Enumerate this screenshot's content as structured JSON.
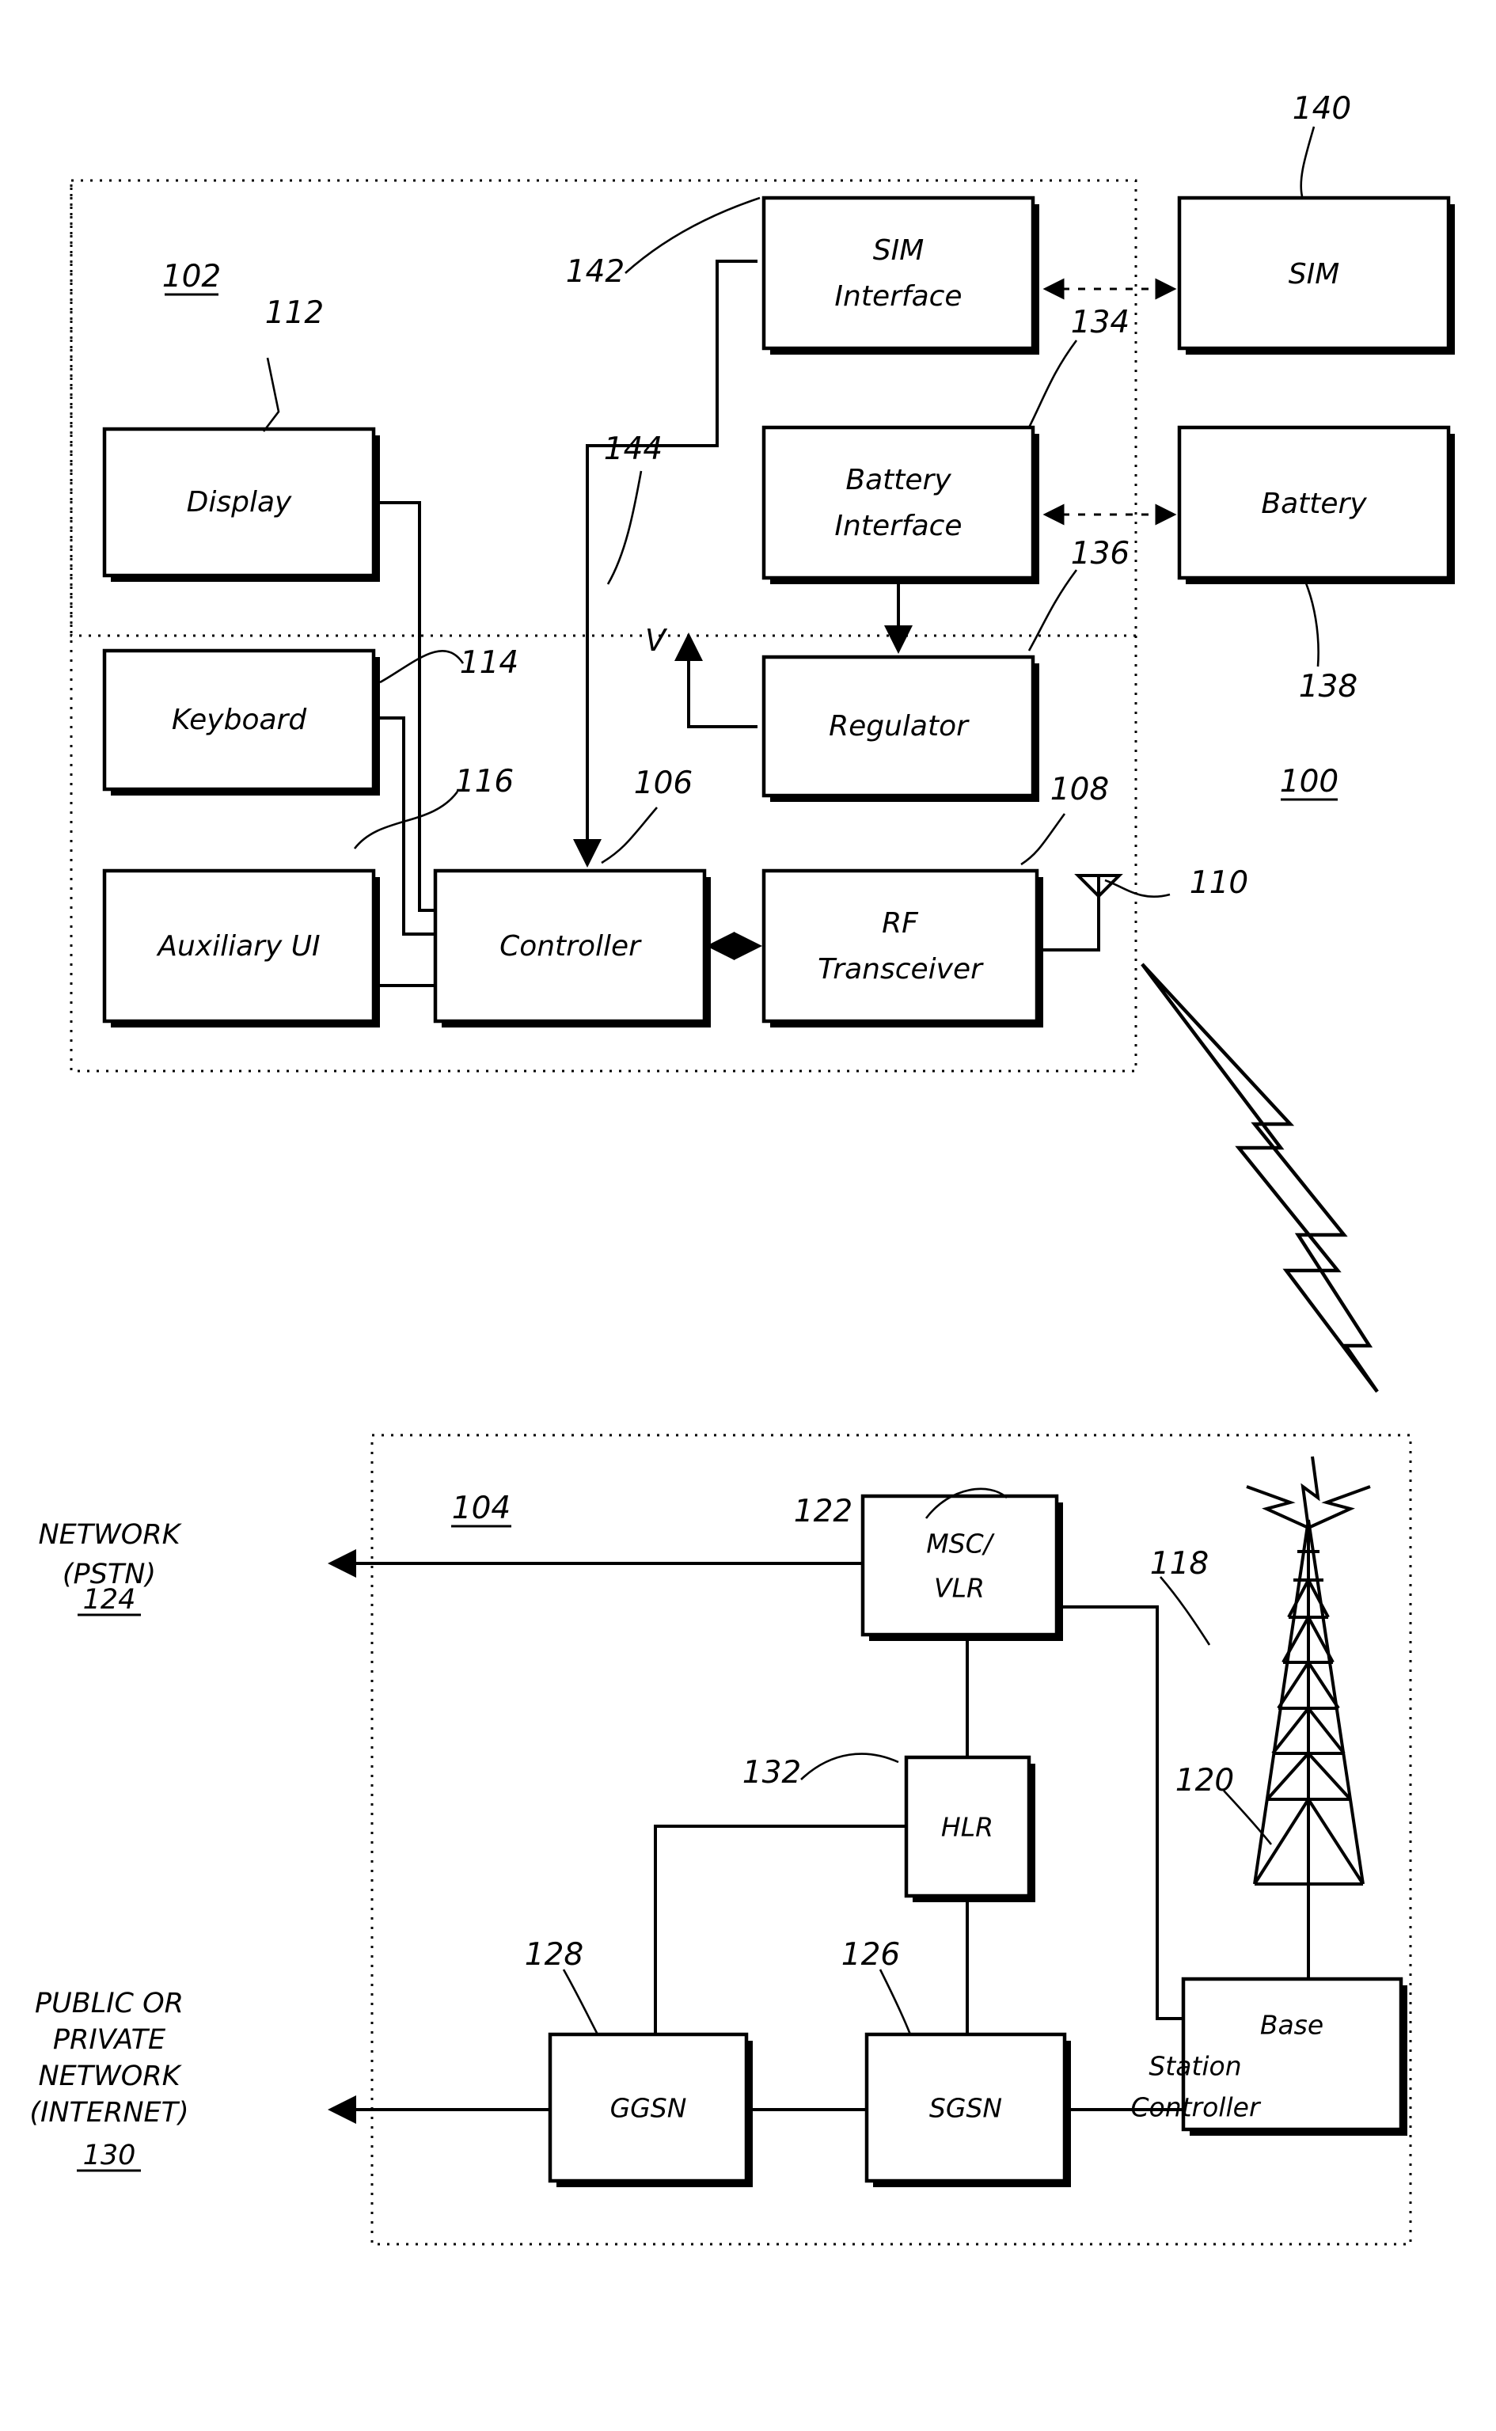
{
  "figure": {
    "type": "patent-block-diagram",
    "device_group_ref": "102",
    "network_group_ref": "104",
    "system_ref": "100"
  },
  "device": {
    "group_ref": "102",
    "blocks": [
      {
        "id": "display",
        "label": "Display",
        "ref": "112"
      },
      {
        "id": "keyboard",
        "label": "Keyboard",
        "ref": "114"
      },
      {
        "id": "auxiliary_ui",
        "label": "Auxiliary UI",
        "ref": "116"
      },
      {
        "id": "controller",
        "label": "Controller",
        "ref": "106"
      },
      {
        "id": "rf_transceiver",
        "label_line1": "RF",
        "label_line2": "Transceiver",
        "ref": "108"
      },
      {
        "id": "sim_interface",
        "label_line1": "SIM",
        "label_line2": "Interface",
        "ref": "142"
      },
      {
        "id": "battery_interface",
        "label_line1": "Battery",
        "label_line2": "Interface",
        "ref": "134"
      },
      {
        "id": "regulator",
        "label": "Regulator",
        "ref": "136"
      }
    ],
    "antenna_ref": "110",
    "sim_bus_ref": "144",
    "voltage_label": "V"
  },
  "external": {
    "blocks": [
      {
        "id": "sim",
        "label": "SIM",
        "ref": "140"
      },
      {
        "id": "battery",
        "label": "Battery",
        "ref": "138"
      }
    ],
    "system_ref": "100"
  },
  "network": {
    "group_ref": "104",
    "blocks": [
      {
        "id": "msc_vlr",
        "label_line1": "MSC/",
        "label_line2": "VLR",
        "ref": "122"
      },
      {
        "id": "hlr",
        "label": "HLR",
        "ref": "132"
      },
      {
        "id": "ggsn",
        "label": "GGSN",
        "ref": "128"
      },
      {
        "id": "sgsn",
        "label": "SGSN",
        "ref": "126"
      },
      {
        "id": "base_station_controller",
        "label_line1": "Base",
        "label_line2": "Station",
        "label_line3": "Controller",
        "ref": "120"
      }
    ],
    "tower_ref": "118",
    "external_networks": [
      {
        "id": "pstn",
        "line1": "NETWORK",
        "line2": "(PSTN)",
        "ref": "124"
      },
      {
        "id": "internet",
        "line1": "PUBLIC OR",
        "line2": "PRIVATE",
        "line3": "NETWORK",
        "line4": "(INTERNET)",
        "ref": "130"
      }
    ]
  },
  "refs": {
    "r100": "100",
    "r102": "102",
    "r104": "104",
    "r106": "106",
    "r108": "108",
    "r110": "110",
    "r112": "112",
    "r114": "114",
    "r116": "116",
    "r118": "118",
    "r120": "120",
    "r122": "122",
    "r124": "124",
    "r126": "126",
    "r128": "128",
    "r130": "130",
    "r132": "132",
    "r134": "134",
    "r136": "136",
    "r138": "138",
    "r140": "140",
    "r142": "142",
    "r144": "144"
  },
  "colors": {
    "ink": "#000000",
    "paper": "#ffffff"
  }
}
